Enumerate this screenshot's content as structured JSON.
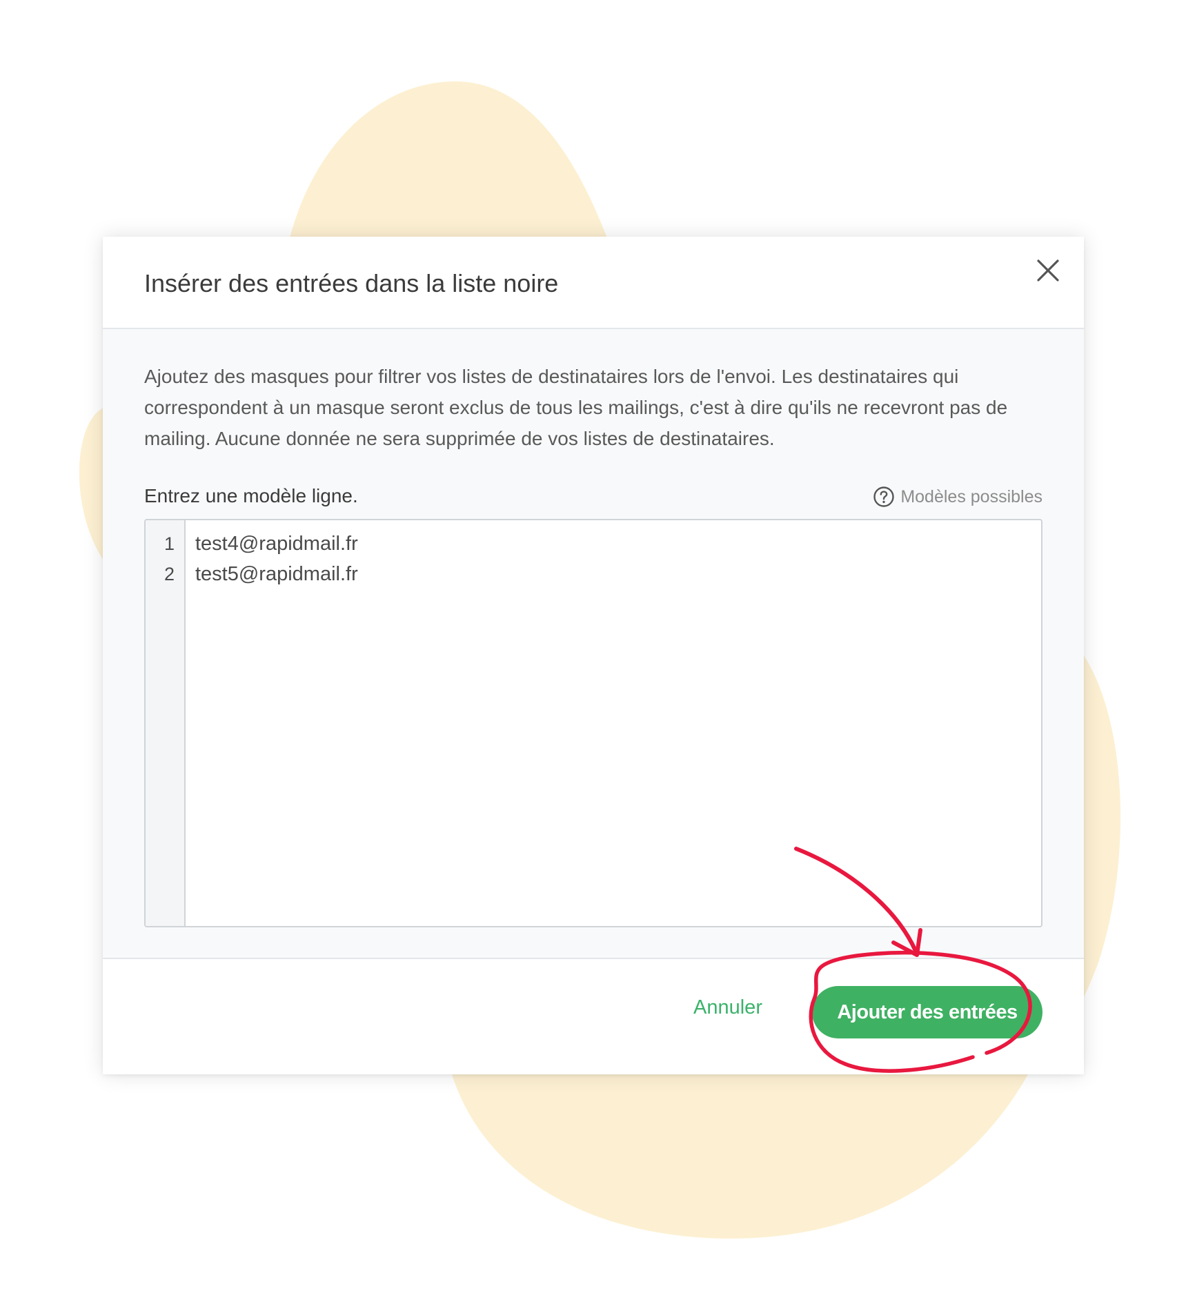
{
  "colors": {
    "blob": "#fdf0d2",
    "accent_green": "#3fb163",
    "annotation_red": "#e8183f"
  },
  "dialog": {
    "title": "Insérer des entrées dans la liste noire",
    "close_icon": "close-icon",
    "description": "Ajoutez des masques pour filtrer vos listes de destinataires lors de l'envoi. Les destinataires qui correspondent à un masque seront exclus de tous les mailings, c'est à dire qu'ils ne recevront pas de mailing. Aucune donnée ne sera supprimée de vos listes de destinataires.",
    "field_label": "Entrez une modèle ligne.",
    "help": {
      "icon": "question-circle-icon",
      "label": "Modèles possibles"
    },
    "editor": {
      "lines": [
        {
          "number": "1",
          "text": "test4@rapidmail.fr"
        },
        {
          "number": "2",
          "text": "test5@rapidmail.fr"
        }
      ]
    },
    "footer": {
      "cancel_label": "Annuler",
      "submit_label": "Ajouter des entrées"
    }
  }
}
